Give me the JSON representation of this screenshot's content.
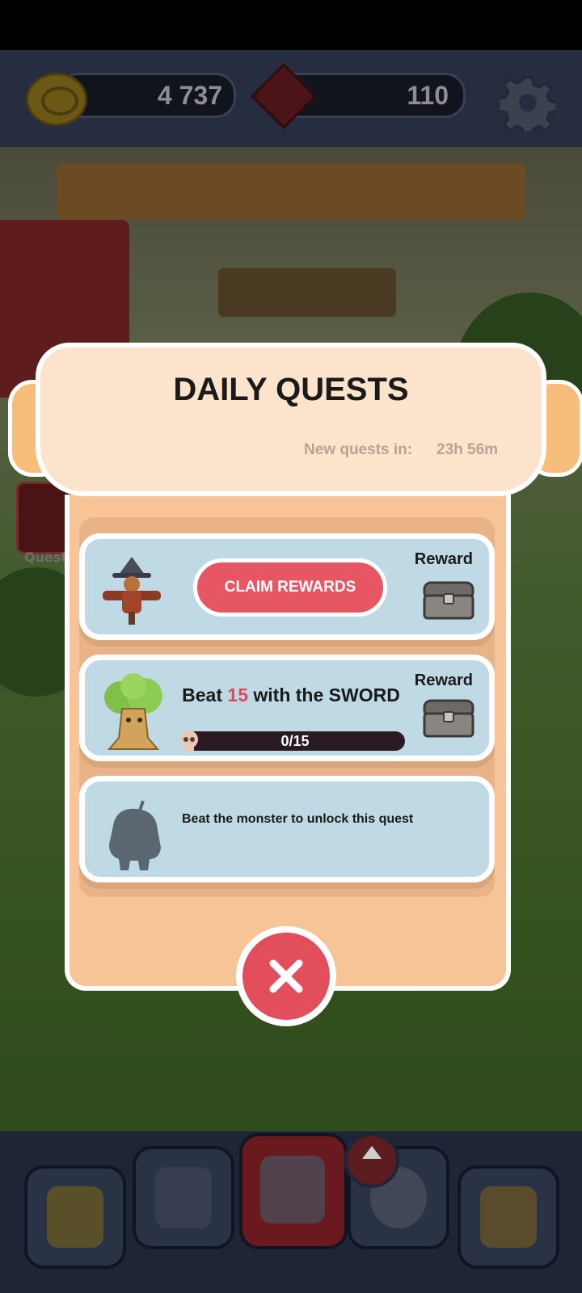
{
  "currency": {
    "coins": "4 737",
    "gems": "110"
  },
  "background": {
    "quests_label": "Quests"
  },
  "modal": {
    "title": "DAILY QUESTS",
    "timer_label": "New quests in:",
    "timer_value": "23h 56m",
    "quests": [
      {
        "icon": "scarecrow-icon",
        "button_label": "CLAIM REWARDS",
        "reward_label": "Reward",
        "reward_icon": "chest-icon"
      },
      {
        "icon": "tree-monster-icon",
        "title_prefix": "Beat ",
        "title_number": "15",
        "title_suffix": " with the SWORD",
        "progress_text": "0/15",
        "progress_fraction": 0,
        "reward_label": "Reward",
        "reward_icon": "chest-icon"
      },
      {
        "icon": "locked-monster-icon",
        "text": "Beat the monster to unlock this quest"
      }
    ],
    "close_icon": "close-icon"
  },
  "colors": {
    "accent_red": "#e75663",
    "card_blue": "#bfdae5",
    "parchment": "#fbe3cc"
  }
}
